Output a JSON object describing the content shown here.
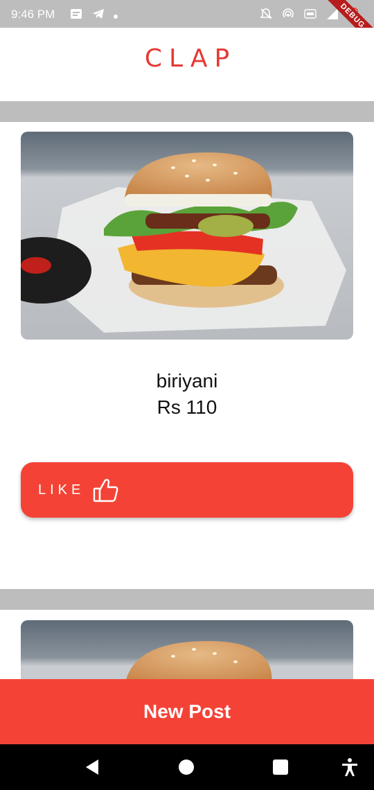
{
  "status_bar": {
    "time": "9:46 PM",
    "left_icons": [
      "message-icon",
      "telegram-icon",
      "notification-dot"
    ],
    "right_icons": [
      "notifications-off-icon",
      "hotspot-icon",
      "volte-icon",
      "signal-4g-icon",
      "battery-low-icon"
    ],
    "debug_label": "DEBUG"
  },
  "app_bar": {
    "title": "CLAP",
    "accent_color": "#e53935"
  },
  "posts": [
    {
      "image": "burger-image",
      "name": "biriyani",
      "price": "Rs 110",
      "like_label": "LIKE",
      "like_icon": "thumbs-up-icon"
    },
    {
      "image": "burger-image"
    }
  ],
  "new_post_button": {
    "label": "New Post"
  },
  "nav_bar": {
    "icons": [
      "back-icon",
      "home-icon",
      "recents-icon",
      "accessibility-icon"
    ]
  },
  "colors": {
    "primary": "#f44336",
    "separator": "#bdbdbd",
    "status_bar": "#bdbdbd"
  }
}
